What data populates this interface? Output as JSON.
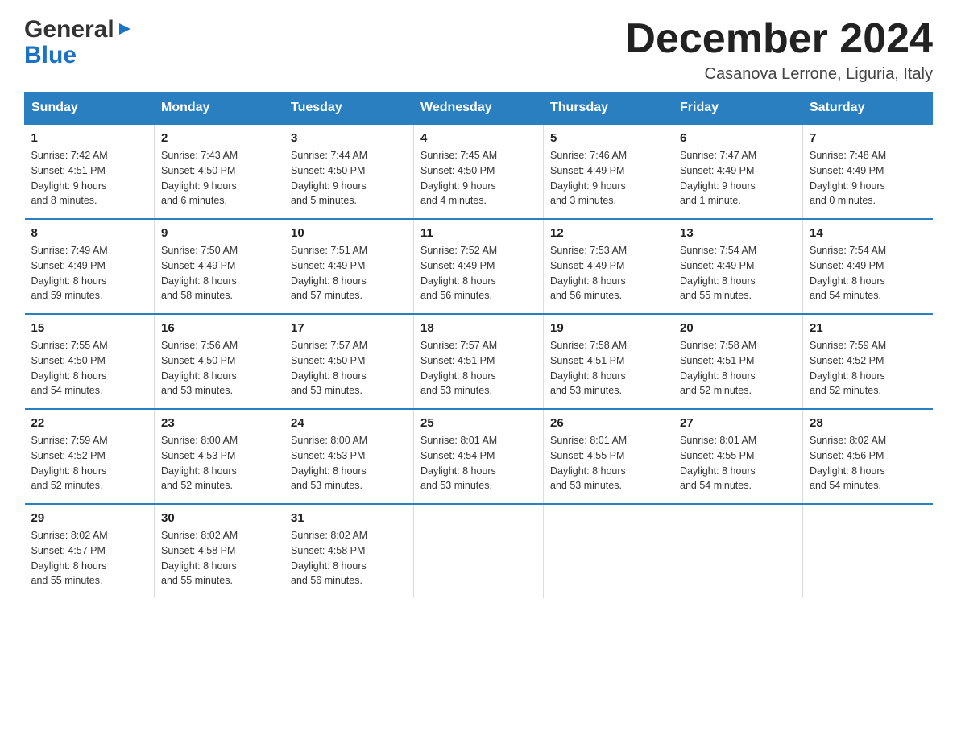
{
  "logo": {
    "line1_regular": "General",
    "line1_triangle": "▶",
    "line2": "Blue"
  },
  "header": {
    "month_title": "December 2024",
    "location": "Casanova Lerrone, Liguria, Italy"
  },
  "weekdays": [
    "Sunday",
    "Monday",
    "Tuesday",
    "Wednesday",
    "Thursday",
    "Friday",
    "Saturday"
  ],
  "weeks": [
    [
      {
        "day": "1",
        "info": "Sunrise: 7:42 AM\nSunset: 4:51 PM\nDaylight: 9 hours\nand 8 minutes."
      },
      {
        "day": "2",
        "info": "Sunrise: 7:43 AM\nSunset: 4:50 PM\nDaylight: 9 hours\nand 6 minutes."
      },
      {
        "day": "3",
        "info": "Sunrise: 7:44 AM\nSunset: 4:50 PM\nDaylight: 9 hours\nand 5 minutes."
      },
      {
        "day": "4",
        "info": "Sunrise: 7:45 AM\nSunset: 4:50 PM\nDaylight: 9 hours\nand 4 minutes."
      },
      {
        "day": "5",
        "info": "Sunrise: 7:46 AM\nSunset: 4:49 PM\nDaylight: 9 hours\nand 3 minutes."
      },
      {
        "day": "6",
        "info": "Sunrise: 7:47 AM\nSunset: 4:49 PM\nDaylight: 9 hours\nand 1 minute."
      },
      {
        "day": "7",
        "info": "Sunrise: 7:48 AM\nSunset: 4:49 PM\nDaylight: 9 hours\nand 0 minutes."
      }
    ],
    [
      {
        "day": "8",
        "info": "Sunrise: 7:49 AM\nSunset: 4:49 PM\nDaylight: 8 hours\nand 59 minutes."
      },
      {
        "day": "9",
        "info": "Sunrise: 7:50 AM\nSunset: 4:49 PM\nDaylight: 8 hours\nand 58 minutes."
      },
      {
        "day": "10",
        "info": "Sunrise: 7:51 AM\nSunset: 4:49 PM\nDaylight: 8 hours\nand 57 minutes."
      },
      {
        "day": "11",
        "info": "Sunrise: 7:52 AM\nSunset: 4:49 PM\nDaylight: 8 hours\nand 56 minutes."
      },
      {
        "day": "12",
        "info": "Sunrise: 7:53 AM\nSunset: 4:49 PM\nDaylight: 8 hours\nand 56 minutes."
      },
      {
        "day": "13",
        "info": "Sunrise: 7:54 AM\nSunset: 4:49 PM\nDaylight: 8 hours\nand 55 minutes."
      },
      {
        "day": "14",
        "info": "Sunrise: 7:54 AM\nSunset: 4:49 PM\nDaylight: 8 hours\nand 54 minutes."
      }
    ],
    [
      {
        "day": "15",
        "info": "Sunrise: 7:55 AM\nSunset: 4:50 PM\nDaylight: 8 hours\nand 54 minutes."
      },
      {
        "day": "16",
        "info": "Sunrise: 7:56 AM\nSunset: 4:50 PM\nDaylight: 8 hours\nand 53 minutes."
      },
      {
        "day": "17",
        "info": "Sunrise: 7:57 AM\nSunset: 4:50 PM\nDaylight: 8 hours\nand 53 minutes."
      },
      {
        "day": "18",
        "info": "Sunrise: 7:57 AM\nSunset: 4:51 PM\nDaylight: 8 hours\nand 53 minutes."
      },
      {
        "day": "19",
        "info": "Sunrise: 7:58 AM\nSunset: 4:51 PM\nDaylight: 8 hours\nand 53 minutes."
      },
      {
        "day": "20",
        "info": "Sunrise: 7:58 AM\nSunset: 4:51 PM\nDaylight: 8 hours\nand 52 minutes."
      },
      {
        "day": "21",
        "info": "Sunrise: 7:59 AM\nSunset: 4:52 PM\nDaylight: 8 hours\nand 52 minutes."
      }
    ],
    [
      {
        "day": "22",
        "info": "Sunrise: 7:59 AM\nSunset: 4:52 PM\nDaylight: 8 hours\nand 52 minutes."
      },
      {
        "day": "23",
        "info": "Sunrise: 8:00 AM\nSunset: 4:53 PM\nDaylight: 8 hours\nand 52 minutes."
      },
      {
        "day": "24",
        "info": "Sunrise: 8:00 AM\nSunset: 4:53 PM\nDaylight: 8 hours\nand 53 minutes."
      },
      {
        "day": "25",
        "info": "Sunrise: 8:01 AM\nSunset: 4:54 PM\nDaylight: 8 hours\nand 53 minutes."
      },
      {
        "day": "26",
        "info": "Sunrise: 8:01 AM\nSunset: 4:55 PM\nDaylight: 8 hours\nand 53 minutes."
      },
      {
        "day": "27",
        "info": "Sunrise: 8:01 AM\nSunset: 4:55 PM\nDaylight: 8 hours\nand 54 minutes."
      },
      {
        "day": "28",
        "info": "Sunrise: 8:02 AM\nSunset: 4:56 PM\nDaylight: 8 hours\nand 54 minutes."
      }
    ],
    [
      {
        "day": "29",
        "info": "Sunrise: 8:02 AM\nSunset: 4:57 PM\nDaylight: 8 hours\nand 55 minutes."
      },
      {
        "day": "30",
        "info": "Sunrise: 8:02 AM\nSunset: 4:58 PM\nDaylight: 8 hours\nand 55 minutes."
      },
      {
        "day": "31",
        "info": "Sunrise: 8:02 AM\nSunset: 4:58 PM\nDaylight: 8 hours\nand 56 minutes."
      },
      {
        "day": "",
        "info": ""
      },
      {
        "day": "",
        "info": ""
      },
      {
        "day": "",
        "info": ""
      },
      {
        "day": "",
        "info": ""
      }
    ]
  ]
}
